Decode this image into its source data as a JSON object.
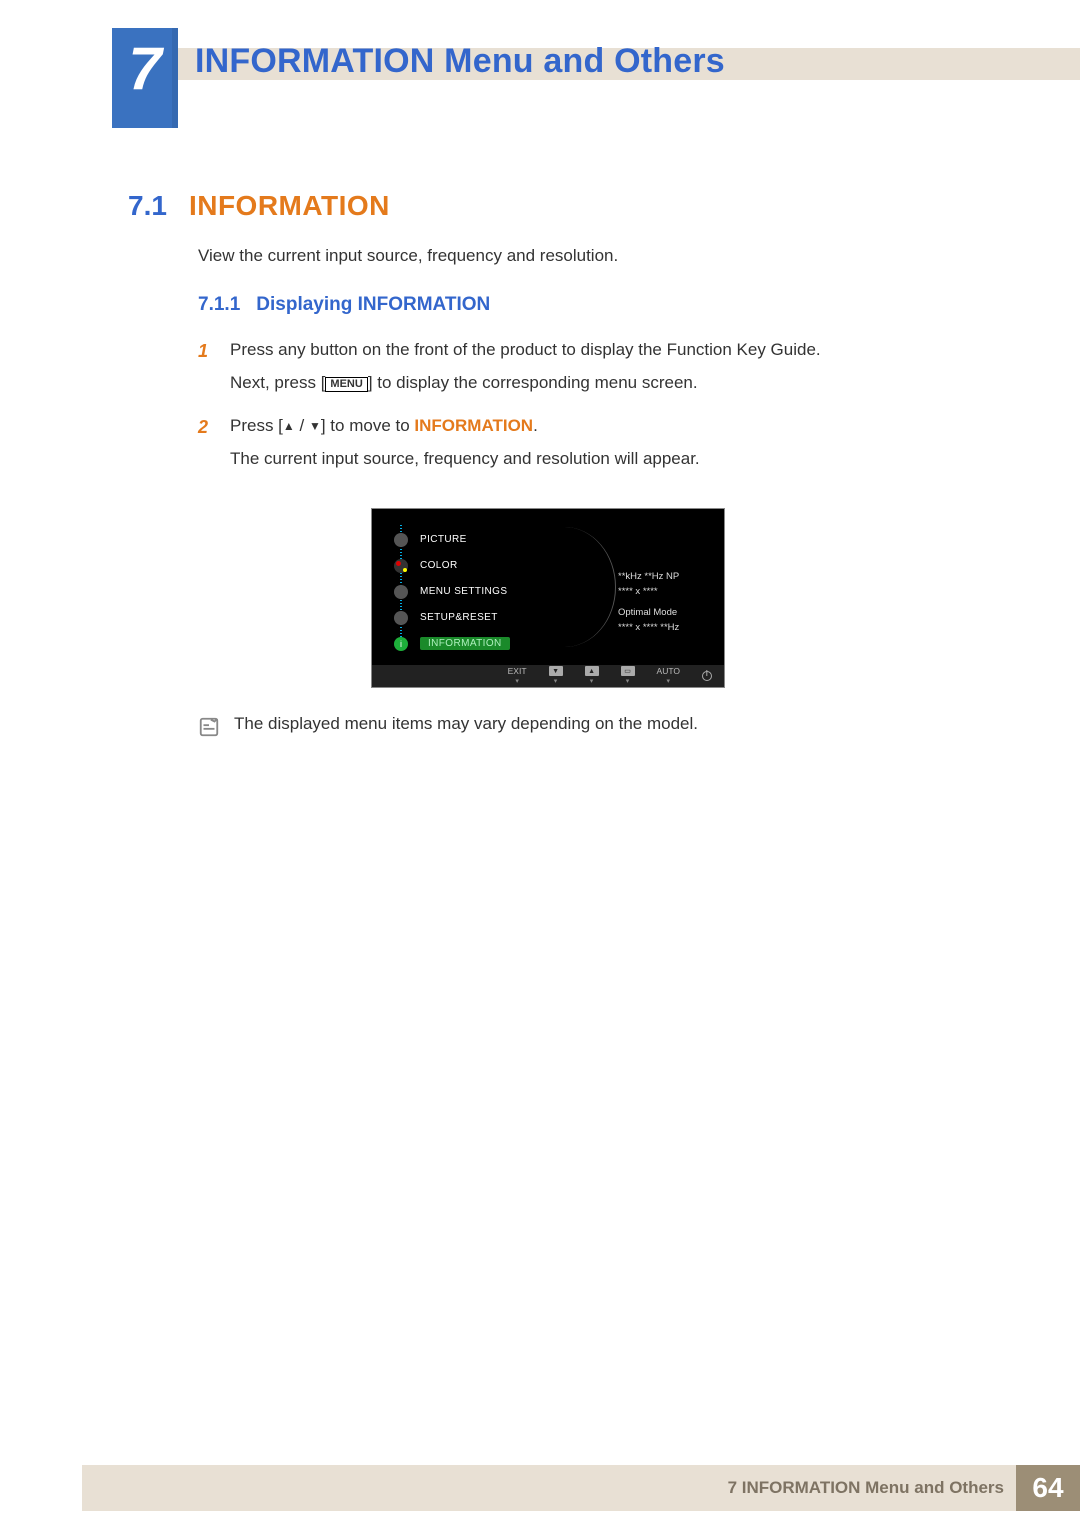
{
  "chapter": {
    "number": "7",
    "title": "INFORMATION Menu and Others"
  },
  "section": {
    "number": "7.1",
    "title": "INFORMATION"
  },
  "section_intro": "View the current input source, frequency and resolution.",
  "subsection": {
    "number": "7.1.1",
    "title": "Displaying INFORMATION"
  },
  "steps": {
    "s1": {
      "num": "1",
      "line1a": "Press any button on the front of the product to display the Function Key Guide.",
      "line2a": "Next, press [",
      "menu_label": "MENU",
      "line2b": "] to display the corresponding menu screen."
    },
    "s2": {
      "num": "2",
      "pressa": "Press [",
      "pressb": "] to move to ",
      "info_ref": "INFORMATION",
      "period": ".",
      "line2": "The current input source, frequency and resolution will appear."
    }
  },
  "osd": {
    "items": [
      "PICTURE",
      "COLOR",
      "MENU SETTINGS",
      "SETUP&RESET",
      "INFORMATION"
    ],
    "right_lines": [
      "**kHz **Hz NP",
      "**** x ****",
      "Optimal Mode",
      "**** x **** **Hz"
    ],
    "footer": {
      "exit": "EXIT",
      "auto": "AUTO"
    }
  },
  "note": "The displayed menu items may vary depending on the model.",
  "footer": {
    "text": "7 INFORMATION Menu and Others",
    "page": "64"
  }
}
